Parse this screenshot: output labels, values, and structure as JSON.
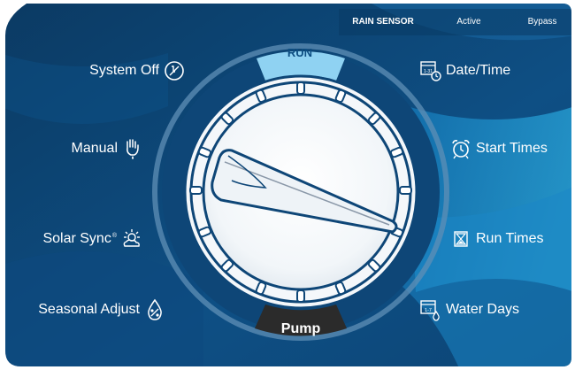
{
  "header": {
    "rain_sensor": "RAIN SENSOR",
    "active": "Active",
    "bypass": "Bypass"
  },
  "dial": {
    "top_label": "RUN",
    "bottom_label": "Pump"
  },
  "left_positions": [
    {
      "label": "System Off",
      "icon": "system-off-icon"
    },
    {
      "label": "Manual",
      "icon": "hand-water-icon"
    },
    {
      "label": "Solar Sync",
      "trademark": "®",
      "icon": "sun-cloud-icon"
    },
    {
      "label": "Seasonal Adjust",
      "icon": "percent-drop-icon"
    }
  ],
  "right_positions": [
    {
      "label": "Date/Time",
      "icon": "calendar-clock-icon",
      "icon_text": "1-31"
    },
    {
      "label": "Start Times",
      "icon": "alarm-clock-icon"
    },
    {
      "label": "Run Times",
      "icon": "hourglass-icon"
    },
    {
      "label": "Water Days",
      "icon": "calendar-drop-icon",
      "icon_text": "1-7"
    }
  ],
  "colors": {
    "panel_dark": "#0c3f6b",
    "panel_mid": "#0f5a93",
    "panel_light": "#27a3d8",
    "run_band": "#8fd2f2",
    "pump_band": "#2b2b2b",
    "text": "#ffffff"
  }
}
